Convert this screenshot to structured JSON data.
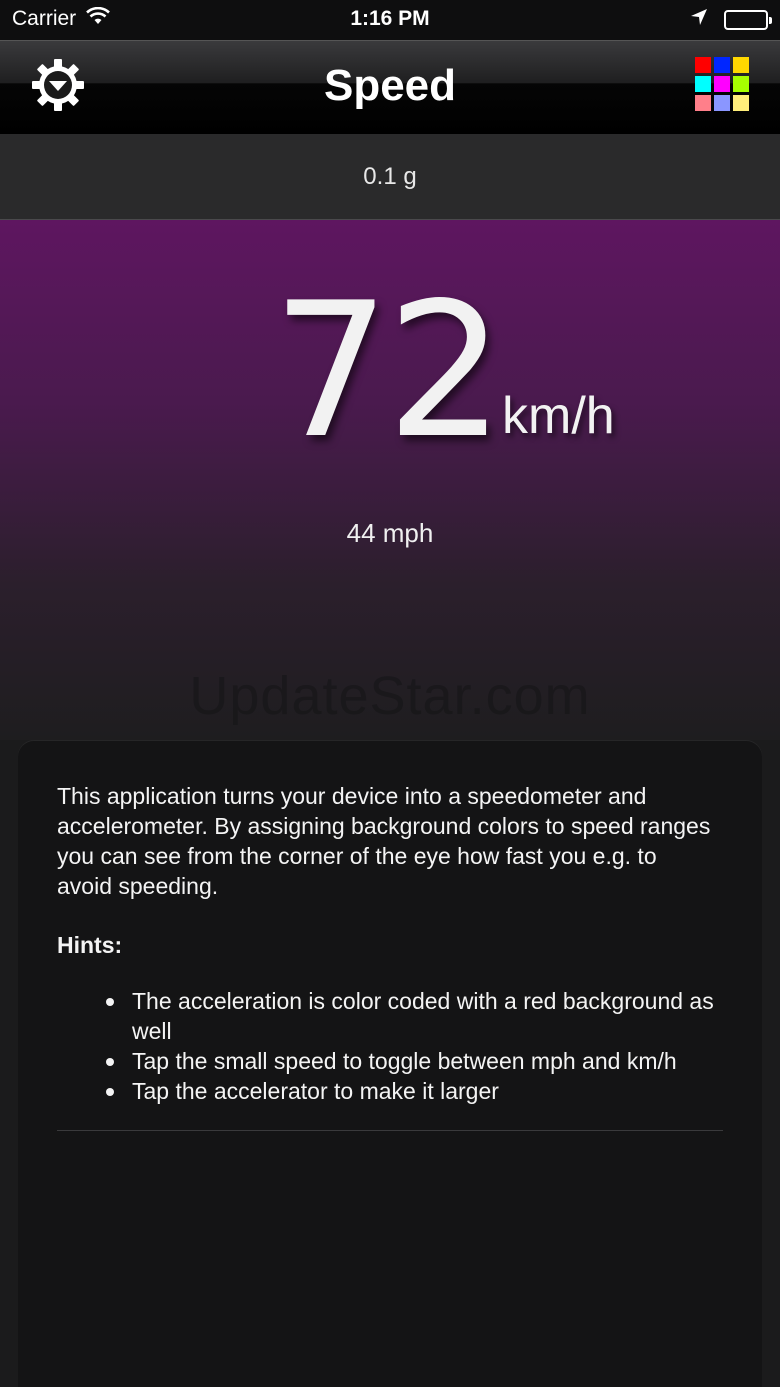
{
  "status_bar": {
    "carrier": "Carrier",
    "time": "1:16 PM",
    "icons": [
      "wifi-icon",
      "location-arrow-icon",
      "battery-icon"
    ]
  },
  "nav": {
    "title": "Speed",
    "left_icon": "settings-gear-icon",
    "right_icon": "color-palette-grid-icon",
    "palette_colors": [
      "#ff0000",
      "#0026ff",
      "#ffd800",
      "#00ffff",
      "#ff00ff",
      "#a6ff00",
      "#ff7f8a",
      "#8a96ff",
      "#ffee7a"
    ]
  },
  "acceleration": {
    "text": "0.1 g"
  },
  "speed": {
    "value": "72",
    "unit": "km/h",
    "alt_text": "44 mph",
    "background_color": "#5e1660"
  },
  "watermark": "UpdateStar.com",
  "info": {
    "description": "This application turns your device into a speedometer and accelerometer. By assigning background colors to speed ranges you can see from the corner of the eye how fast you e.g. to avoid speeding.",
    "hints_title": "Hints:",
    "hints": [
      "The acceleration is color coded with a red background as well",
      "Tap the small speed to toggle between mph and km/h",
      "Tap the accelerator to make it larger"
    ]
  }
}
